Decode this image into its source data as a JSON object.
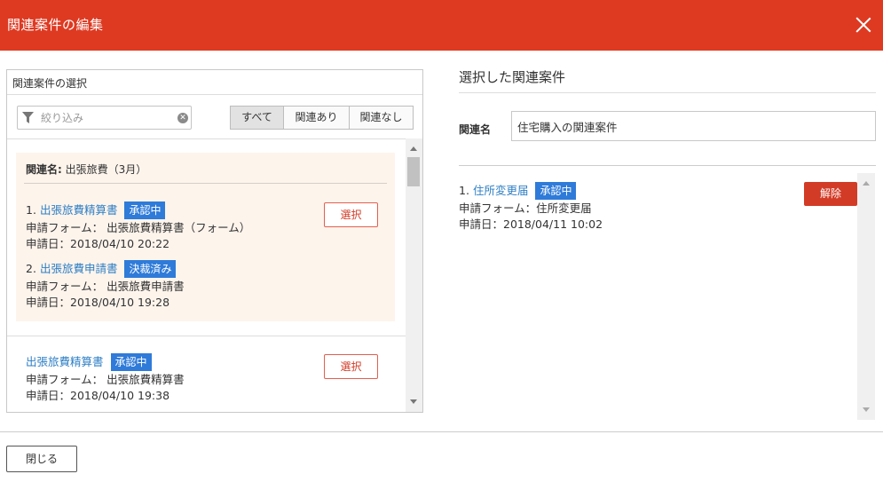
{
  "header": {
    "title": "関連案件の編集",
    "close_icon": "close-icon"
  },
  "left": {
    "title": "関連案件の選択",
    "search": {
      "placeholder": "絞り込み",
      "value": ""
    },
    "filters": [
      {
        "label": "すべて",
        "active": true
      },
      {
        "label": "関連あり",
        "active": false
      },
      {
        "label": "関連なし",
        "active": false
      }
    ],
    "group": {
      "label_prefix": "関連名:",
      "label_value": "出張旅費（3月）",
      "items": [
        {
          "num": "1.",
          "title": "出張旅費精算書",
          "status": "承認中",
          "form": "申請フォーム： 出張旅費精算書（フォーム）",
          "date": "申請日：2018/04/10 20:22"
        },
        {
          "num": "2.",
          "title": "出張旅費申請書",
          "status": "決裁済み",
          "form": "申請フォーム： 出張旅費申請書",
          "date": "申請日：2018/04/10 19:28"
        }
      ]
    },
    "single": {
      "title": "出張旅費精算書",
      "status": "承認中",
      "form": "申請フォーム： 出張旅費精算書",
      "date": "申請日：2018/04/10 19:38"
    },
    "select_label": "選択"
  },
  "right": {
    "title": "選択した関連案件",
    "rel_label": "関連名",
    "rel_value": "住宅購入の関連案件",
    "items": [
      {
        "num": "1.",
        "title": "住所変更届",
        "status": "承認中",
        "form": "申請フォーム：住所変更届",
        "date": "申請日：2018/04/11 10:02"
      }
    ],
    "unlink_label": "解除"
  },
  "footer": {
    "close_label": "閉じる"
  },
  "colors": {
    "header": "#de3a22",
    "link": "#2e7fc5",
    "badge": "#2f7bd9",
    "danger": "#d23b26"
  }
}
